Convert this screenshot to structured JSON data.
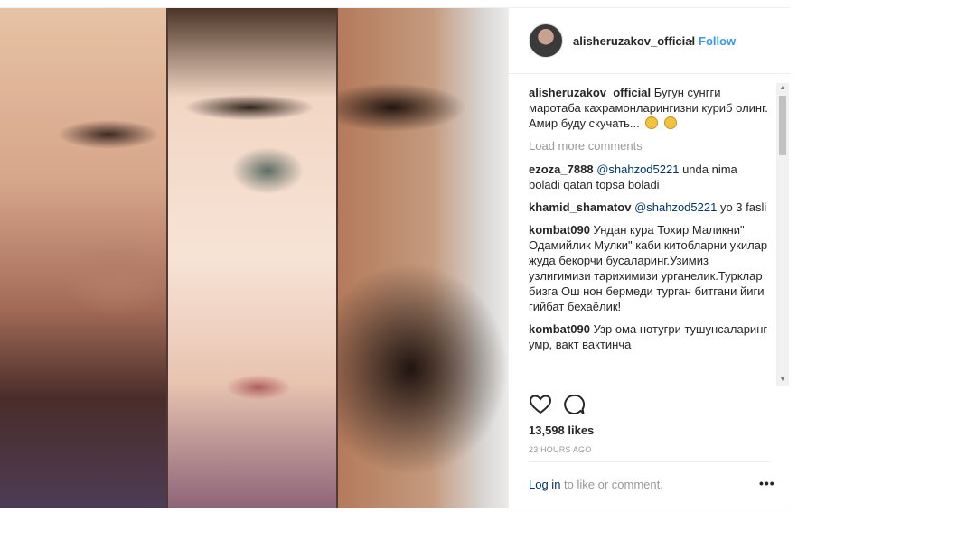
{
  "post": {
    "header": {
      "username": "alisheruzakov_official",
      "separator": "•",
      "follow_label": "Follow"
    },
    "caption": {
      "username": "alisheruzakov_official",
      "text": "Бугун сунгги маротаба кахрамонларингизни куриб олинг.",
      "text2": "Амир буду скучать..."
    },
    "load_more": "Load more comments",
    "comments": [
      {
        "username": "ezoza_7888",
        "mention": "@shahzod5221",
        "text": " unda nima boladi qatan topsa boladi"
      },
      {
        "username": "khamid_shamatov",
        "mention": "@shahzod5221",
        "text": " yo 3 fasli"
      },
      {
        "username": "kombat090",
        "mention": "",
        "text": " Ундан кура Тохир Маликни\" Одамийлик Мулки\" каби китобларни укилар жуда бекорчи бусаларинг.Узимиз узлигимизи тарихимизи урганелик.Турклар бизга Ош нон бермеди турган битгани йиги гийбат бехаёлик!"
      },
      {
        "username": "kombat090",
        "mention": "",
        "text": " Узр ома нотугри тушунсаларинг умр, вакт вактинча"
      }
    ],
    "icons": {
      "like": "heart-icon",
      "comment": "comment-bubble-icon",
      "more": "more-dots-icon"
    },
    "likes": "13,598 likes",
    "timestamp": "23 HOURS AGO",
    "login": {
      "link": "Log in",
      "rest": " to like or comment."
    },
    "more_label": "•••",
    "scroll": {
      "up": "▲",
      "down": "▼"
    },
    "colors": {
      "accent": "#3897f0",
      "text": "#262626",
      "muted": "#999999",
      "link": "#003569"
    }
  }
}
